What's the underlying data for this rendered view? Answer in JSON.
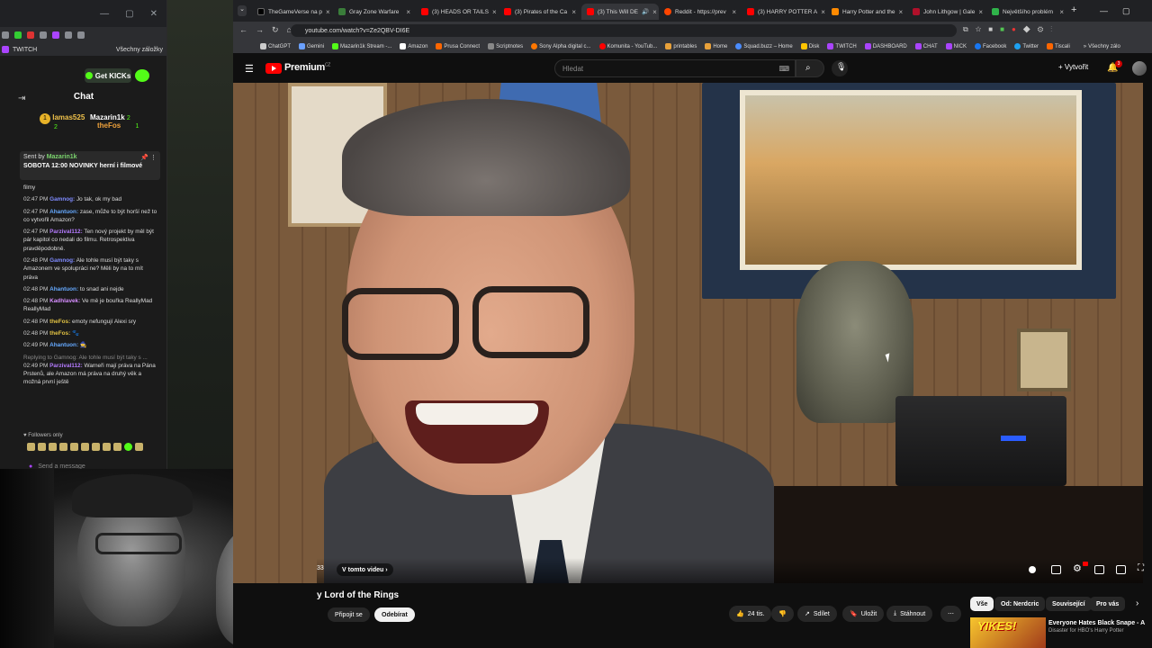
{
  "left_window": {
    "bookmark": "TWITCH",
    "bookmark_all": "Všechny záložky",
    "get_kicks": "Get KICKs",
    "chat_title": "Chat",
    "leaderboard": [
      {
        "name": "lamas525",
        "count": "2"
      },
      {
        "name": "Mazarin1k",
        "count": "2"
      },
      {
        "name": "theFos",
        "count": "1"
      }
    ],
    "pinned": {
      "sent_by": "Sent by",
      "author": "Mazarin1k",
      "message": "SOBOTA 12:00 NOVINKY herní i filmové"
    },
    "messages": [
      {
        "time": "",
        "user": "",
        "text": "filmy"
      },
      {
        "time": "02:47 PM",
        "user": "Gamnog:",
        "text": "Jo tak, ok my bad"
      },
      {
        "time": "02:47 PM",
        "user": "Ahantuon:",
        "text": "zase, může to být horší než to co vytvořil Amazon?"
      },
      {
        "time": "02:47 PM",
        "user": "Parzival112:",
        "text": "Ten nový projekt by měl být pár kapitol co nedali do filmu. Retrospektiva pravděpodobně."
      },
      {
        "time": "02:48 PM",
        "user": "Gamnog:",
        "text": "Ale tohle musí být taky s Amazonem ve spolupráci ne? Měli by na to mít práva"
      },
      {
        "time": "02:48 PM",
        "user": "Ahantuon:",
        "text": "to snad ani nejde"
      },
      {
        "time": "02:48 PM",
        "user": "Kadhlavek:",
        "text": "Ve mě je bouřka ReallyMad ReallyMad"
      },
      {
        "time": "02:48 PM",
        "user": "theFos:",
        "text": "emoty nefungují Alexi sry"
      },
      {
        "time": "02:48 PM",
        "user": "theFos:",
        "text": ""
      },
      {
        "time": "02:49 PM",
        "user": "Ahantuon:",
        "text": ""
      },
      {
        "time": "02:49 PM",
        "user": "Parzival112:",
        "text": "Warneři mají práva na Pána Prstenů, ale Amazon má práva na druhý věk a možná první ještě",
        "reply": "Replying to Gamnog: Ale tohle musí být taky s ..."
      }
    ],
    "followers_only": "Followers only",
    "send_placeholder": "Send a message"
  },
  "tabs": [
    {
      "label": "TheGameVerse na p",
      "color": "#000000"
    },
    {
      "label": "Gray Zone Warfare",
      "color": "#3a7d3a"
    },
    {
      "label": "(3) HEADS OR TAILS",
      "color": "#ff0000"
    },
    {
      "label": "(3) Pirates of the Ca",
      "color": "#ff0000"
    },
    {
      "label": "(3) This Will DE",
      "color": "#ff0000"
    },
    {
      "label": "Reddit - https://prev",
      "color": "#ff4500"
    },
    {
      "label": "(3) HARRY POTTER A",
      "color": "#ff0000"
    },
    {
      "label": "Harry Potter and the",
      "color": "#ff8a00"
    },
    {
      "label": "John Lithgow | Gale",
      "color": "#b0102a"
    },
    {
      "label": "Největšího problém",
      "color": "#2fb34a"
    }
  ],
  "address": {
    "url": "youtube.com/watch?v=Ze2QBV-DI6E"
  },
  "bookmarks": [
    "ChatGPT",
    "Gemini",
    "Mazarin1k Stream -...",
    "Amazon",
    "Prusa Connect",
    "Scriptnotes",
    "Sony Alpha digital c...",
    "Komunita - YouTub...",
    "printables",
    "Home",
    "Squad.buzz – Home",
    "Disk",
    "TWITCH",
    "DASHBOARD",
    "CHAT",
    "NICK",
    "Facebook",
    "Twitter",
    "Tiscali"
  ],
  "bookmarks_all": "Všechny zálo",
  "youtube": {
    "premium": "Premium",
    "premium_country": "CZ",
    "search_placeholder": "Hledat",
    "create": "Vytvořit",
    "notif_count": "3"
  },
  "player": {
    "time": "33",
    "in_this_video": "V tomto videu ›"
  },
  "video": {
    "title": "y Lord of the Rings",
    "join": "Připojit se",
    "subscribe": "Odebírat",
    "likes": "24 tis.",
    "share": "Sdílet",
    "save": "Uložit",
    "download": "Stáhnout"
  },
  "chips": [
    "Vše",
    "Od: Nerdcric",
    "Související",
    "Pro vás"
  ],
  "recommendation": {
    "thumb_text": "YIKES!",
    "title": "Everyone Hates Black Snape - A",
    "subtitle": "Disaster for HBO's Harry Potter"
  }
}
